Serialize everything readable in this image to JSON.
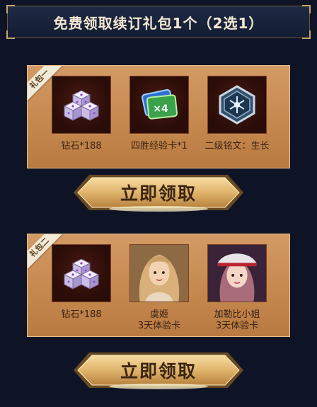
{
  "title": "免费领取续订礼包1个（2选1）",
  "packs": [
    {
      "tag": "礼包一",
      "items": [
        {
          "icon": "diamond-dice-icon",
          "name": "钻石*188"
        },
        {
          "icon": "exp-card-icon",
          "name": "四胜经验卡*1"
        },
        {
          "icon": "inscription-emblem-icon",
          "name": "二级铭文：生长"
        }
      ],
      "button": "立即领取"
    },
    {
      "tag": "礼包二",
      "items": [
        {
          "icon": "diamond-dice-icon",
          "name": "钻石*188"
        },
        {
          "icon": "hero-portrait-yuji",
          "name_line1": "虞姬",
          "name_line2": "3天体验卡"
        },
        {
          "icon": "hero-portrait-jiaqinbi",
          "name_line1": "加勒比小姐",
          "name_line2": "3天体验卡"
        }
      ],
      "button": "立即领取"
    }
  ],
  "colors": {
    "background": "#0e1426",
    "panel": "#c5894f",
    "button_gold": "#e0b46c",
    "title_text": "#f3e8d2",
    "item_text": "#3a2210"
  }
}
